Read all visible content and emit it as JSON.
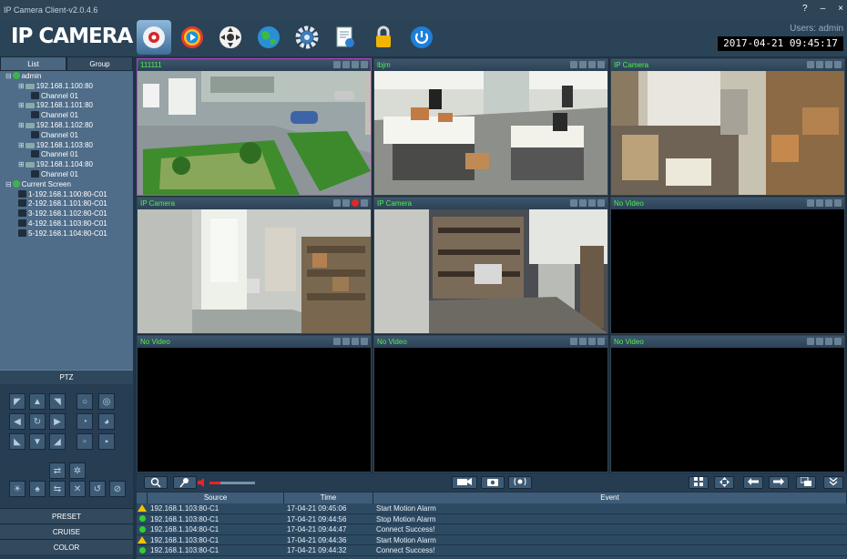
{
  "app": {
    "title": "IP Camera Client-v2.0.4.6",
    "logo": "IP CAMERA",
    "help": "?",
    "minimize": "–",
    "close": "×"
  },
  "header": {
    "user_label": "Users: admin",
    "datetime": "2017-04-21  09:45:17"
  },
  "toolbar": [
    {
      "name": "camera-view-icon",
      "active": true
    },
    {
      "name": "playback-icon",
      "active": false
    },
    {
      "name": "ptz-wheel-icon",
      "active": false
    },
    {
      "name": "globe-icon",
      "active": false
    },
    {
      "name": "settings-gear-icon",
      "active": false
    },
    {
      "name": "log-document-icon",
      "active": false
    },
    {
      "name": "lock-icon",
      "active": false
    },
    {
      "name": "power-icon",
      "active": false
    }
  ],
  "left_panel": {
    "tabs": [
      "List",
      "Group"
    ],
    "tree": [
      {
        "label": "admin",
        "indent": 0,
        "type": "root"
      },
      {
        "label": "192.168.1.100:80",
        "indent": 1,
        "type": "device"
      },
      {
        "label": "Channel 01",
        "indent": 2,
        "type": "channel"
      },
      {
        "label": "192.168.1.101:80",
        "indent": 1,
        "type": "device"
      },
      {
        "label": "Channel 01",
        "indent": 2,
        "type": "channel"
      },
      {
        "label": "192.168.1.102:80",
        "indent": 1,
        "type": "device"
      },
      {
        "label": "Channel 01",
        "indent": 2,
        "type": "channel"
      },
      {
        "label": "192.168.1.103:80",
        "indent": 1,
        "type": "device"
      },
      {
        "label": "Channel 01",
        "indent": 2,
        "type": "channel"
      },
      {
        "label": "192.168.1.104:80",
        "indent": 1,
        "type": "device"
      },
      {
        "label": "Channel 01",
        "indent": 2,
        "type": "channel"
      },
      {
        "label": "Current Screen",
        "indent": 0,
        "type": "root"
      },
      {
        "label": "1-192.168.1.100:80-C01",
        "indent": 1,
        "type": "screen"
      },
      {
        "label": "2-192.168.1.101:80-C01",
        "indent": 1,
        "type": "screen"
      },
      {
        "label": "3-192.168.1.102:80-C01",
        "indent": 1,
        "type": "screen"
      },
      {
        "label": "4-192.168.1.103:80-C01",
        "indent": 1,
        "type": "screen"
      },
      {
        "label": "5-192.168.1.104:80-C01",
        "indent": 1,
        "type": "screen"
      }
    ],
    "ptz_label": "PTZ",
    "buttons": [
      "PRESET",
      "CRUISE",
      "COLOR"
    ]
  },
  "video_grid": {
    "cells": [
      {
        "title": "111111",
        "has_video": true,
        "scene": "outdoor",
        "selected": true,
        "recording": false
      },
      {
        "title": "lbjm",
        "has_video": true,
        "scene": "office",
        "selected": false,
        "recording": false
      },
      {
        "title": "IP Camera",
        "has_video": true,
        "scene": "warehouse",
        "selected": false,
        "recording": false
      },
      {
        "title": "IP Camera",
        "has_video": true,
        "scene": "corridor",
        "selected": false,
        "recording": true
      },
      {
        "title": "IP Camera",
        "has_video": true,
        "scene": "storeroom",
        "selected": false,
        "recording": false
      },
      {
        "title": "No Video",
        "has_video": false,
        "selected": false,
        "recording": false
      },
      {
        "title": "No Video",
        "has_video": false,
        "selected": false,
        "recording": false
      },
      {
        "title": "No Video",
        "has_video": false,
        "selected": false,
        "recording": false
      },
      {
        "title": "No Video",
        "has_video": false,
        "selected": false,
        "recording": false
      }
    ]
  },
  "events": {
    "columns": [
      "Source",
      "Time",
      "Event"
    ],
    "rows": [
      {
        "status": "warn",
        "source": "192.168.1.103:80-C1",
        "time": "17-04-21 09:45:06",
        "event": "Start Motion Alarm"
      },
      {
        "status": "ok",
        "source": "192.168.1.103:80-C1",
        "time": "17-04-21 09:44:56",
        "event": "Stop Motion Alarm"
      },
      {
        "status": "ok",
        "source": "192.168.1.104:80-C1",
        "time": "17-04-21 09:44:47",
        "event": "Connect Success!"
      },
      {
        "status": "warn",
        "source": "192.168.1.103:80-C1",
        "time": "17-04-21 09:44:36",
        "event": "Start Motion Alarm"
      },
      {
        "status": "ok",
        "source": "192.168.1.103:80-C1",
        "time": "17-04-21 09:44:32",
        "event": "Connect Success!"
      }
    ]
  },
  "colors": {
    "accent": "#4ef14e",
    "alarm": "#f2c200",
    "record": "#e02828",
    "selected_border": "#b04ac0"
  }
}
